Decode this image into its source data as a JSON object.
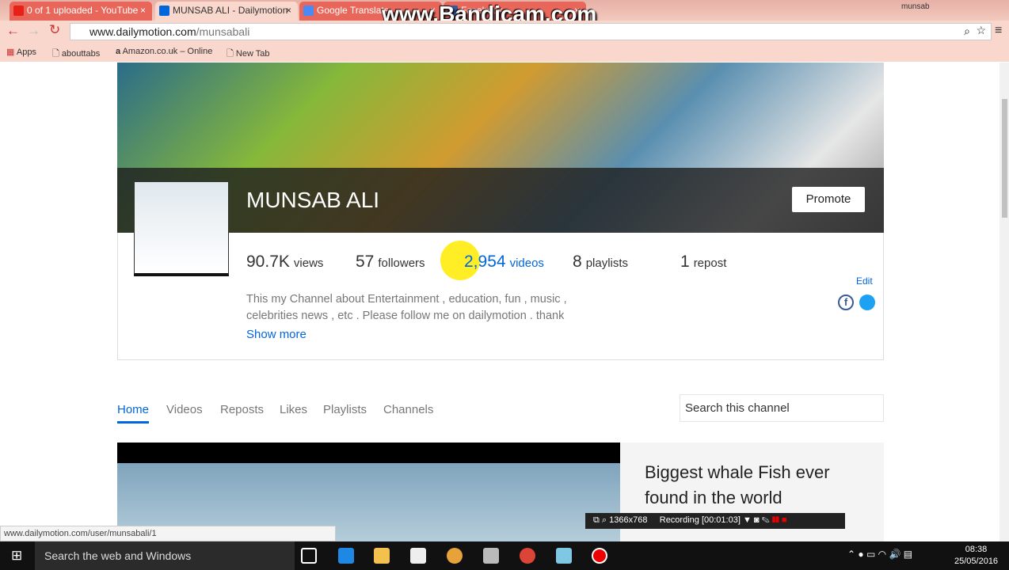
{
  "browser": {
    "tabs": [
      {
        "title": "0 of 1 uploaded - YouTube"
      },
      {
        "title": "MUNSAB ALI - Dailymotion"
      },
      {
        "title": "Google Translate"
      },
      {
        "title": "Facebook"
      }
    ],
    "url_domain": "www.dailymotion.com",
    "url_path": "/munsabali",
    "profile_name": "munsab",
    "bookmarks": [
      "Apps",
      "abouttabs",
      "Amazon.co.uk – Online",
      "New Tab"
    ],
    "status_url": "www.dailymotion.com/user/munsabali/1"
  },
  "watermark": "www.Bandicam.com",
  "channel": {
    "name": "MUNSAB ALI",
    "promote": "Promote",
    "stats": [
      {
        "value": "90.7K",
        "label": "views"
      },
      {
        "value": "57",
        "label": "followers"
      },
      {
        "value": "2,954",
        "label": "videos"
      },
      {
        "value": "8",
        "label": "playlists"
      },
      {
        "value": "1",
        "label": "repost"
      }
    ],
    "description": "This my Channel about Entertainment , education, fun , music , celebrities news , etc . Please follow me on dailymotion . thank",
    "show_more": "Show more",
    "edit": "Edit"
  },
  "nav": {
    "tabs": [
      "Home",
      "Videos",
      "Reposts",
      "Likes",
      "Playlists",
      "Channels"
    ],
    "search_placeholder": "Search this channel"
  },
  "featured": {
    "title": "Biggest whale Fish ever found in the world"
  },
  "recorder": {
    "resolution": "1366x768",
    "status": "Recording [00:01:03]"
  },
  "taskbar": {
    "search": "Search the web and Windows",
    "time": "08:38",
    "date": "25/05/2016"
  }
}
